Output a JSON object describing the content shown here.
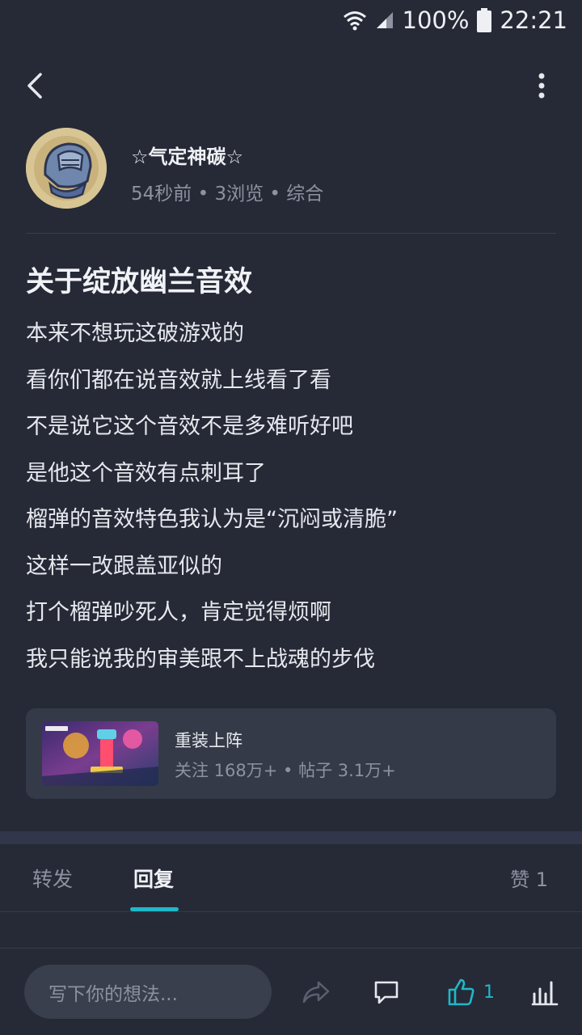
{
  "status_bar": {
    "battery": "100%",
    "time": "22:21",
    "icons": [
      "wifi-icon",
      "signal-icon",
      "battery-icon"
    ]
  },
  "topbar": {
    "icons": [
      "back-arrow-icon",
      "more-vertical-icon"
    ]
  },
  "author": {
    "name": "☆气定神碳☆",
    "meta": "54秒前 • 3浏览 • 综合"
  },
  "post": {
    "title": "关于绽放幽兰音效",
    "lines": [
      "本来不想玩这破游戏的",
      "看你们都在说音效就上线看了看",
      "不是说它这个音效不是多难听好吧",
      "是他这个音效有点刺耳了",
      "榴弹的音效特色我认为是“沉闷或清脆”",
      "这样一改跟盖亚似的",
      "打个榴弹吵死人，肯定觉得烦啊",
      "我只能说我的审美跟不上战魂的步伐"
    ]
  },
  "game_card": {
    "name": "重装上阵",
    "stats": "关注 168万+ • 帖子 3.1万+"
  },
  "tabs": {
    "forward": "转发",
    "reply": "回复",
    "like": "赞 1"
  },
  "bottom_bar": {
    "input_placeholder": "写下你的想法...",
    "like_count": "1",
    "icons": [
      "share-icon",
      "comment-icon",
      "thumbs-up-icon",
      "ranking-icon"
    ]
  },
  "colors": {
    "background": "#262a36",
    "card": "#353a48",
    "accent": "#1fb8c8",
    "muted_text": "#8c92a0"
  }
}
